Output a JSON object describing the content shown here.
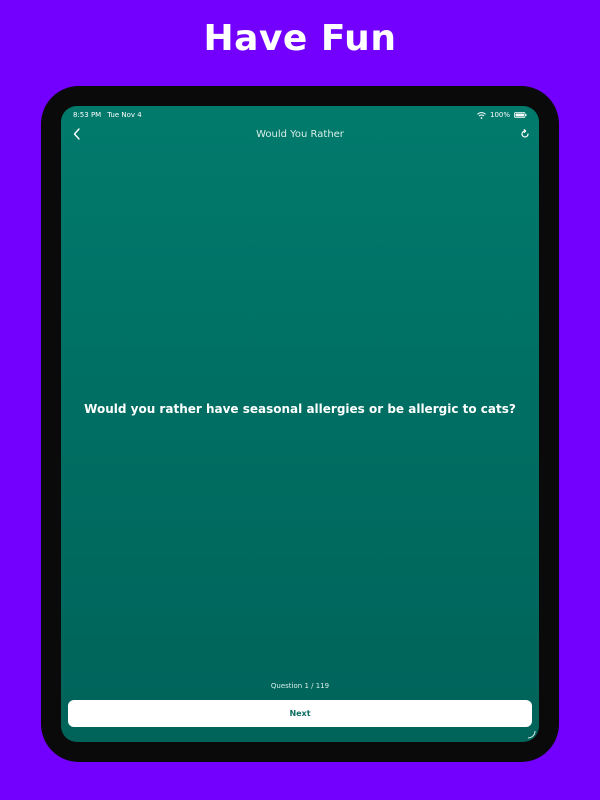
{
  "banner": {
    "headline": "Have Fun"
  },
  "status_bar": {
    "time": "8:53 PM",
    "date": "Tue Nov 4",
    "battery": "100%"
  },
  "nav": {
    "title": "Would You Rather",
    "back_icon": "chevron-left-icon",
    "refresh_icon": "refresh-icon"
  },
  "game": {
    "question": "Would you rather have seasonal allergies or be allergic to cats?",
    "counter": "Question 1 / 119",
    "next_label": "Next"
  },
  "colors": {
    "background": "#7300ff",
    "screen_top": "#017a6c",
    "screen_bottom": "#00635a",
    "button_text": "#0b6e63"
  }
}
